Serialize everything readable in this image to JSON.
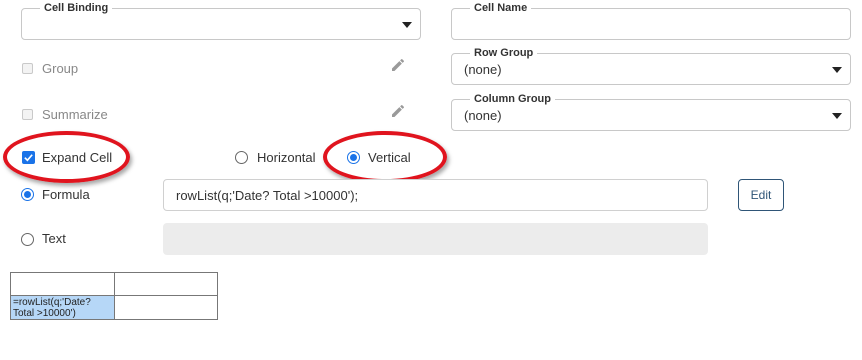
{
  "cell_binding": {
    "label": "Cell Binding",
    "value": ""
  },
  "cell_name": {
    "label": "Cell Name",
    "value": ""
  },
  "row_group": {
    "label": "Row Group",
    "value": "(none)"
  },
  "column_group": {
    "label": "Column Group",
    "value": "(none)"
  },
  "group": {
    "label": "Group",
    "checked": false,
    "enabled": false
  },
  "summarize": {
    "label": "Summarize",
    "checked": false,
    "enabled": false
  },
  "expand_cell": {
    "label": "Expand Cell",
    "checked": true
  },
  "orientation": {
    "horizontal_label": "Horizontal",
    "vertical_label": "Vertical",
    "selected": "Vertical"
  },
  "formula": {
    "label": "Formula",
    "selected": true,
    "value": "rowList(q;'Date? Total >10000');"
  },
  "text": {
    "label": "Text",
    "selected": false,
    "value": ""
  },
  "edit_button": {
    "label": "Edit"
  },
  "preview": {
    "cell_text": "=rowList(q;'Date?",
    "cell_text_overflow": "Total >10000')"
  },
  "colors": {
    "accent": "#1a73e8",
    "highlight": "#e0141e",
    "selected_cell": "#b6d7f7"
  },
  "icons": {
    "dropdown": "caret-down-icon",
    "edit": "pencil-icon"
  }
}
